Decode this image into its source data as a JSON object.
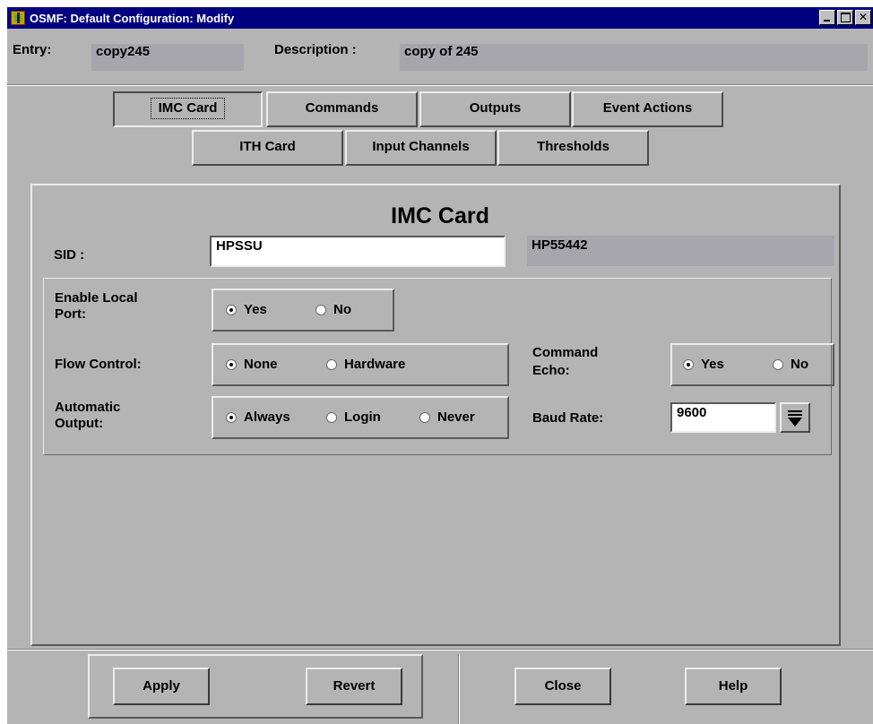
{
  "window": {
    "title": "OSMF: Default Configuration: Modify",
    "icon": "app-icon",
    "controls": [
      "minimize-icon",
      "maximize-icon",
      "close-icon"
    ],
    "close_glyph": "✕"
  },
  "header": {
    "entry_label": "Entry:",
    "entry_value": "copy245",
    "description_label": "Description :",
    "description_value": "copy of 245"
  },
  "tabs": {
    "row1": [
      "IMC Card",
      "Commands",
      "Outputs",
      "Event Actions"
    ],
    "row2": [
      "ITH Card",
      "Input Channels",
      "Thresholds"
    ],
    "active": "IMC Card"
  },
  "panel": {
    "title": "IMC Card",
    "sid_label": "SID :",
    "sid_value": "HPSSU",
    "sid_info": "HP55442"
  },
  "settings": {
    "enable_local_port": {
      "label_line1": "Enable Local",
      "label_line2": "Port:",
      "options": [
        "Yes",
        "No"
      ],
      "selected": "Yes"
    },
    "flow_control": {
      "label": "Flow Control:",
      "options": [
        "None",
        "Hardware"
      ],
      "selected": "None"
    },
    "automatic_output": {
      "label_line1": "Automatic",
      "label_line2": "Output:",
      "options": [
        "Always",
        "Login",
        "Never"
      ],
      "selected": "Always"
    },
    "command_echo": {
      "label_line1": "Command",
      "label_line2": "Echo:",
      "options": [
        "Yes",
        "No"
      ],
      "selected": "Yes"
    },
    "baud_rate": {
      "label": "Baud Rate:",
      "value": "9600"
    }
  },
  "footer": {
    "apply": "Apply",
    "revert": "Revert",
    "close": "Close",
    "help": "Help"
  },
  "colors": {
    "window_bg": "#b4b4b4",
    "titlebar": "#000080",
    "readonly_field": "#a6a6ac",
    "input_bg": "#ffffff"
  }
}
